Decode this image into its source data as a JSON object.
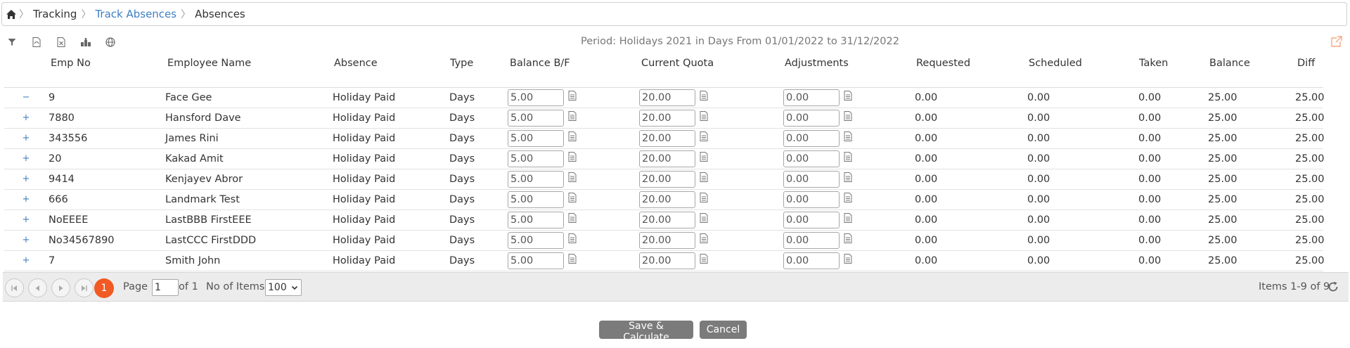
{
  "breadcrumb": {
    "items": [
      "Tracking",
      "Track Absences",
      "Absences"
    ]
  },
  "toolbar": {
    "icons": [
      "filter-icon",
      "pdf-icon",
      "excel-icon",
      "group-icon",
      "globe-icon"
    ]
  },
  "period_text": "Period:  Holidays 2021 in Days From 01/01/2022 to 31/12/2022",
  "columns": {
    "emp_no": "Emp No",
    "name": "Employee Name",
    "absence": "Absence",
    "type": "Type",
    "balance_bf": "Balance B/F",
    "current_quota": "Current Quota",
    "adjustments": "Adjustments",
    "requested": "Requested",
    "scheduled": "Scheduled",
    "taken": "Taken",
    "balance": "Balance",
    "diff": "Diff"
  },
  "rows": [
    {
      "expander": "−",
      "emp_no": "9",
      "name": "Face Gee",
      "absence": "Holiday Paid",
      "type": "Days",
      "balance_bf": "5.00",
      "current_quota": "20.00",
      "adjustments": "0.00",
      "requested": "0.00",
      "scheduled": "0.00",
      "taken": "0.00",
      "balance": "25.00",
      "diff": "25.00"
    },
    {
      "expander": "+",
      "emp_no": "7880",
      "name": "Hansford Dave",
      "absence": "Holiday Paid",
      "type": "Days",
      "balance_bf": "5.00",
      "current_quota": "20.00",
      "adjustments": "0.00",
      "requested": "0.00",
      "scheduled": "0.00",
      "taken": "0.00",
      "balance": "25.00",
      "diff": "25.00"
    },
    {
      "expander": "+",
      "emp_no": "343556",
      "name": "James Rini",
      "absence": "Holiday Paid",
      "type": "Days",
      "balance_bf": "5.00",
      "current_quota": "20.00",
      "adjustments": "0.00",
      "requested": "0.00",
      "scheduled": "0.00",
      "taken": "0.00",
      "balance": "25.00",
      "diff": "25.00"
    },
    {
      "expander": "+",
      "emp_no": "20",
      "name": "Kakad Amit",
      "absence": "Holiday Paid",
      "type": "Days",
      "balance_bf": "5.00",
      "current_quota": "20.00",
      "adjustments": "0.00",
      "requested": "0.00",
      "scheduled": "0.00",
      "taken": "0.00",
      "balance": "25.00",
      "diff": "25.00"
    },
    {
      "expander": "+",
      "emp_no": "9414",
      "name": "Kenjayev Abror",
      "absence": "Holiday Paid",
      "type": "Days",
      "balance_bf": "5.00",
      "current_quota": "20.00",
      "adjustments": "0.00",
      "requested": "0.00",
      "scheduled": "0.00",
      "taken": "0.00",
      "balance": "25.00",
      "diff": "25.00"
    },
    {
      "expander": "+",
      "emp_no": "666",
      "name": "Landmark Test",
      "absence": "Holiday Paid",
      "type": "Days",
      "balance_bf": "5.00",
      "current_quota": "20.00",
      "adjustments": "0.00",
      "requested": "0.00",
      "scheduled": "0.00",
      "taken": "0.00",
      "balance": "25.00",
      "diff": "25.00"
    },
    {
      "expander": "+",
      "emp_no": "NoEEEE",
      "name": "LastBBB FirstEEE",
      "absence": "Holiday Paid",
      "type": "Days",
      "balance_bf": "5.00",
      "current_quota": "20.00",
      "adjustments": "0.00",
      "requested": "0.00",
      "scheduled": "0.00",
      "taken": "0.00",
      "balance": "25.00",
      "diff": "25.00"
    },
    {
      "expander": "+",
      "emp_no": "No34567890",
      "name": "LastCCC FirstDDD",
      "absence": "Holiday Paid",
      "type": "Days",
      "balance_bf": "5.00",
      "current_quota": "20.00",
      "adjustments": "0.00",
      "requested": "0.00",
      "scheduled": "0.00",
      "taken": "0.00",
      "balance": "25.00",
      "diff": "25.00"
    },
    {
      "expander": "+",
      "emp_no": "7",
      "name": "Smith John",
      "absence": "Holiday Paid",
      "type": "Days",
      "balance_bf": "5.00",
      "current_quota": "20.00",
      "adjustments": "0.00",
      "requested": "0.00",
      "scheduled": "0.00",
      "taken": "0.00",
      "balance": "25.00",
      "diff": "25.00"
    }
  ],
  "pager": {
    "current_page": "1",
    "page_label": "Page",
    "page_value": "1",
    "of_label": "of 1",
    "items_label": "No of Items",
    "items_value": "100",
    "summary": "Items 1-9 of 9"
  },
  "actions": {
    "save_label": "Save & Calculate",
    "cancel_label": "Cancel"
  },
  "colors": {
    "accent": "#f15a22",
    "link": "#3d7fc4",
    "button": "#7b7b7b"
  }
}
